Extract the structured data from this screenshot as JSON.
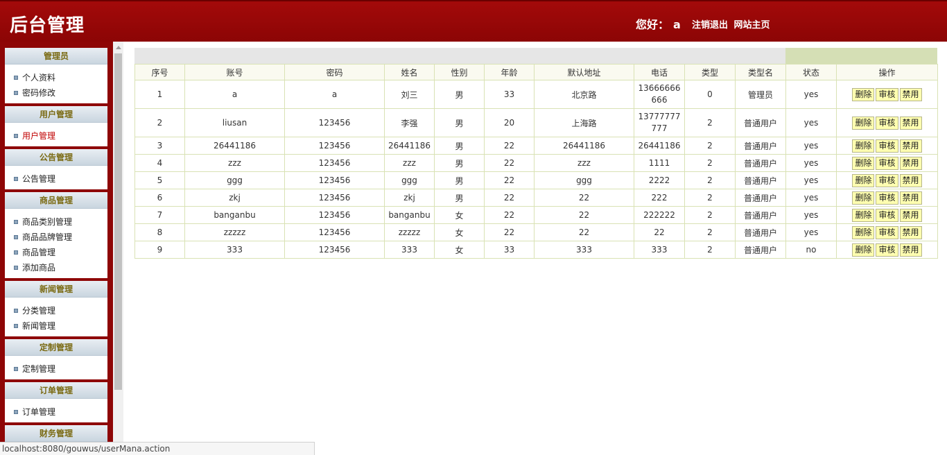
{
  "header": {
    "title": "后台管理",
    "greeting": "您好：",
    "username": "a",
    "logout": "注销退出",
    "home": "网站主页"
  },
  "sidebar": {
    "groups": [
      {
        "title": "管理员",
        "items": [
          "个人资料",
          "密码修改"
        ]
      },
      {
        "title": "用户管理",
        "items": [
          "用户管理"
        ]
      },
      {
        "title": "公告管理",
        "items": [
          "公告管理"
        ]
      },
      {
        "title": "商品管理",
        "items": [
          "商品类别管理",
          "商品品牌管理",
          "商品管理",
          "添加商品"
        ]
      },
      {
        "title": "新闻管理",
        "items": [
          "分类管理",
          "新闻管理"
        ]
      },
      {
        "title": "定制管理",
        "items": [
          "定制管理"
        ]
      },
      {
        "title": "订单管理",
        "items": [
          "订单管理"
        ]
      },
      {
        "title": "财务管理",
        "items": []
      }
    ]
  },
  "table": {
    "columns": [
      "序号",
      "账号",
      "密码",
      "姓名",
      "性别",
      "年龄",
      "默认地址",
      "电话",
      "类型",
      "类型名",
      "状态",
      "操作"
    ],
    "actions": [
      "删除",
      "审核",
      "禁用"
    ],
    "rows": [
      [
        "1",
        "a",
        "a",
        "刘三",
        "男",
        "33",
        "北京路",
        "13666666666",
        "0",
        "管理员",
        "yes"
      ],
      [
        "2",
        "liusan",
        "123456",
        "李强",
        "男",
        "20",
        "上海路",
        "13777777777",
        "2",
        "普通用户",
        "yes"
      ],
      [
        "3",
        "26441186",
        "123456",
        "26441186",
        "男",
        "22",
        "26441186",
        "26441186",
        "2",
        "普通用户",
        "yes"
      ],
      [
        "4",
        "zzz",
        "123456",
        "zzz",
        "男",
        "22",
        "zzz",
        "1111",
        "2",
        "普通用户",
        "yes"
      ],
      [
        "5",
        "ggg",
        "123456",
        "ggg",
        "男",
        "22",
        "ggg",
        "2222",
        "2",
        "普通用户",
        "yes"
      ],
      [
        "6",
        "zkj",
        "123456",
        "zkj",
        "男",
        "22",
        "22",
        "222",
        "2",
        "普通用户",
        "yes"
      ],
      [
        "7",
        "banganbu",
        "123456",
        "banganbu",
        "女",
        "22",
        "22",
        "222222",
        "2",
        "普通用户",
        "yes"
      ],
      [
        "8",
        "zzzzz",
        "123456",
        "zzzzz",
        "女",
        "22",
        "22",
        "22",
        "2",
        "普通用户",
        "yes"
      ],
      [
        "9",
        "333",
        "123456",
        "333",
        "女",
        "33",
        "333",
        "333",
        "2",
        "普通用户",
        "no"
      ]
    ]
  },
  "statusbar": {
    "url": "localhost:8080/gouwus/userMana.action"
  }
}
